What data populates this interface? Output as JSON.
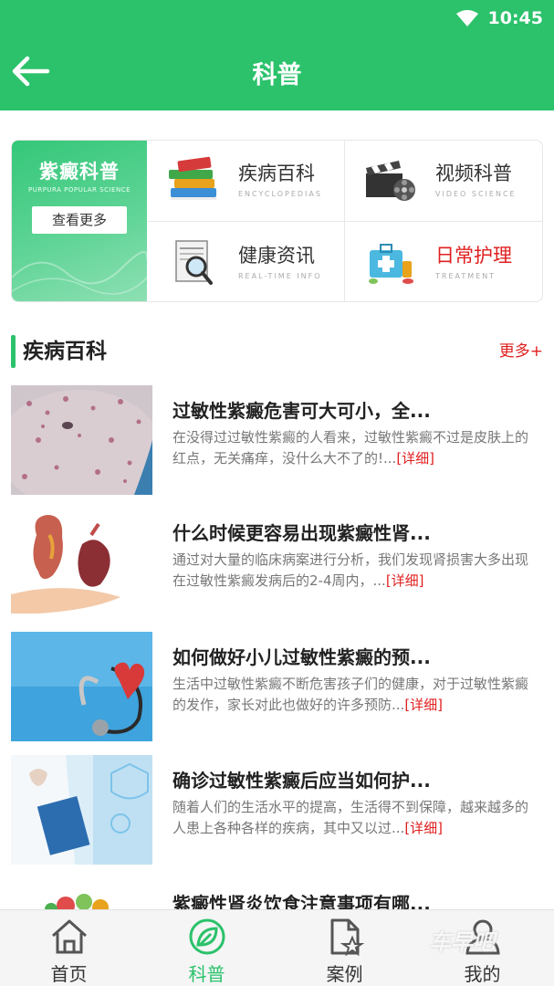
{
  "status": {
    "time": "10:45"
  },
  "header": {
    "title": "科普"
  },
  "banner": {
    "title": "紫癜科普",
    "subtitle": "PURPURA POPULAR SCIENCE",
    "button": "查看更多"
  },
  "grid": [
    {
      "label": "疾病百科",
      "en": "ENCYCLOPEDIAS",
      "icon": "books-icon"
    },
    {
      "label": "视频科普",
      "en": "VIDEO SCIENCE",
      "icon": "clapperboard-icon"
    },
    {
      "label": "健康资讯",
      "en": "REAL-TIME INFO",
      "icon": "newspaper-magnifier-icon"
    },
    {
      "label": "日常护理",
      "en": "TREATMENT",
      "icon": "medicine-kit-icon",
      "highlight": "#e02020"
    }
  ],
  "section": {
    "title": "疾病百科",
    "more": "更多+"
  },
  "articles": [
    {
      "title": "过敏性紫癜危害可大可小，全...",
      "desc": "在没得过过敏性紫癜的人看来，过敏性紫癜不过是皮肤上的红点，无关痛痒，没什么大不了的!...",
      "more": "[详细]"
    },
    {
      "title": "什么时候更容易出现紫癜性肾...",
      "desc": "通过对大量的临床病案进行分析，我们发现肾损害大多出现在过敏性紫癜发病后的2-4周内，...",
      "more": "[详细]"
    },
    {
      "title": "如何做好小儿过敏性紫癜的预...",
      "desc": "生活中过敏性紫癜不断危害孩子们的健康，对于过敏性紫癜的发作，家长对此也做好的许多预防...",
      "more": "[详细]"
    },
    {
      "title": "确诊过敏性紫癜后应当如何护...",
      "desc": "随着人们的生活水平的提高，生活得不到保障，越来越多的人患上各种各样的疾病，其中又以过...",
      "more": "[详细]"
    },
    {
      "title": "紫癜性肾炎饮食注意事项有哪...",
      "desc": "",
      "more": ""
    }
  ],
  "nav": [
    {
      "label": "首页",
      "icon": "home-icon"
    },
    {
      "label": "科普",
      "icon": "leaf-icon",
      "active": true
    },
    {
      "label": "案例",
      "icon": "document-star-icon"
    },
    {
      "label": "我的",
      "icon": "user-icon"
    }
  ],
  "watermark": "车早吧",
  "colors": {
    "primary": "#2bc26b",
    "accent": "#e02020"
  }
}
